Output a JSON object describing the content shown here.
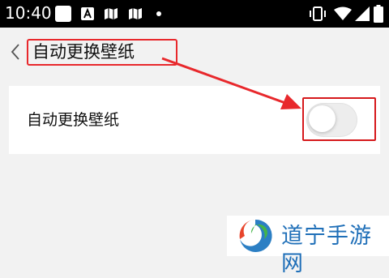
{
  "status_bar": {
    "time": "10:40",
    "icons": [
      "white-square-icon",
      "a-square-icon",
      "map-icon",
      "map-icon",
      "dot-icon",
      "vibrate-icon",
      "wifi-icon",
      "signal-icon",
      "battery-icon"
    ]
  },
  "header": {
    "title": "自动更换壁纸",
    "back_icon": "chevron-left-icon"
  },
  "setting": {
    "label": "自动更换壁纸",
    "toggle_state": "off"
  },
  "annotation": {
    "color": "#e8282c"
  },
  "watermark": {
    "text": "道宁手游网"
  },
  "colors": {
    "background": "#f2f2f2",
    "card": "#ffffff",
    "annotation_red": "#e8282c",
    "watermark_blue": "#1f6fb8"
  }
}
